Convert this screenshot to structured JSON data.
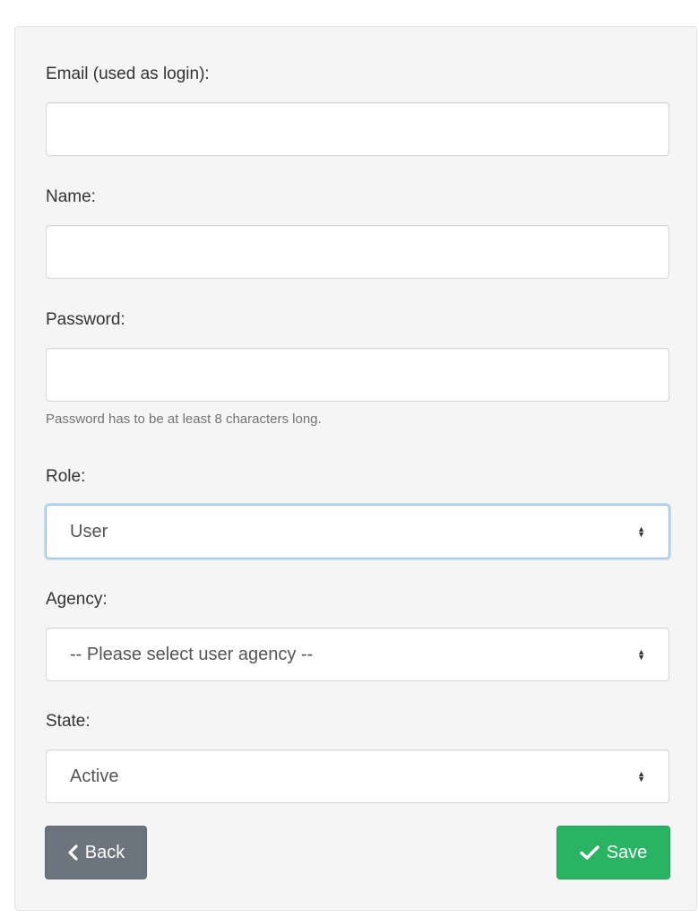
{
  "form": {
    "email": {
      "label": "Email (used as login):",
      "value": "",
      "placeholder": ""
    },
    "name": {
      "label": "Name:",
      "value": "",
      "placeholder": ""
    },
    "password": {
      "label": "Password:",
      "value": "",
      "placeholder": "",
      "help": "Password has to be at least 8 characters long."
    },
    "role": {
      "label": "Role:",
      "selected": "User"
    },
    "agency": {
      "label": "Agency:",
      "selected": "-- Please select user agency --"
    },
    "state": {
      "label": "State:",
      "selected": "Active"
    }
  },
  "actions": {
    "back_label": "Back",
    "save_label": "Save"
  },
  "icons": {
    "back": "chevron-left-icon",
    "save": "check-icon",
    "select": "sort-caret-icon"
  },
  "colors": {
    "back_button": "#6c757d",
    "save_button": "#28b463",
    "focus_ring": "#8fbcec"
  }
}
